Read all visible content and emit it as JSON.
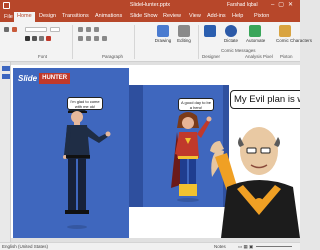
{
  "titlebar": {
    "title": "SlideHunter.pptx",
    "user": "Farshad Iqbal",
    "window_controls": "–▢✕"
  },
  "tabs": [
    "File",
    "Home",
    "Design",
    "Transitions",
    "Animations",
    "Slide Show",
    "Review",
    "View",
    "Add-ins",
    "Help",
    "Pixton"
  ],
  "ribbon": {
    "groups": [
      "Font",
      "Paragraph",
      "Designer",
      "Comic Messages",
      "Analysis Pixel",
      "Pixton"
    ],
    "buttons": [
      "Drawing",
      "Editing",
      "Dictate",
      "Automate",
      "Comic Characters"
    ]
  },
  "slide": {
    "logo": {
      "part1": "Slide",
      "part2": "HUNTER"
    },
    "bubble1": "I'm glad to come with me ok!",
    "bubble2": "A good day to be a hero!",
    "bubble3": "My Evil plan is wo"
  },
  "statusbar": {
    "language": "English (United States)",
    "notes": "Notes"
  },
  "colors": {
    "accent": "#b7472a",
    "panel": "#3f67be",
    "logo_red": "#c0392b"
  }
}
